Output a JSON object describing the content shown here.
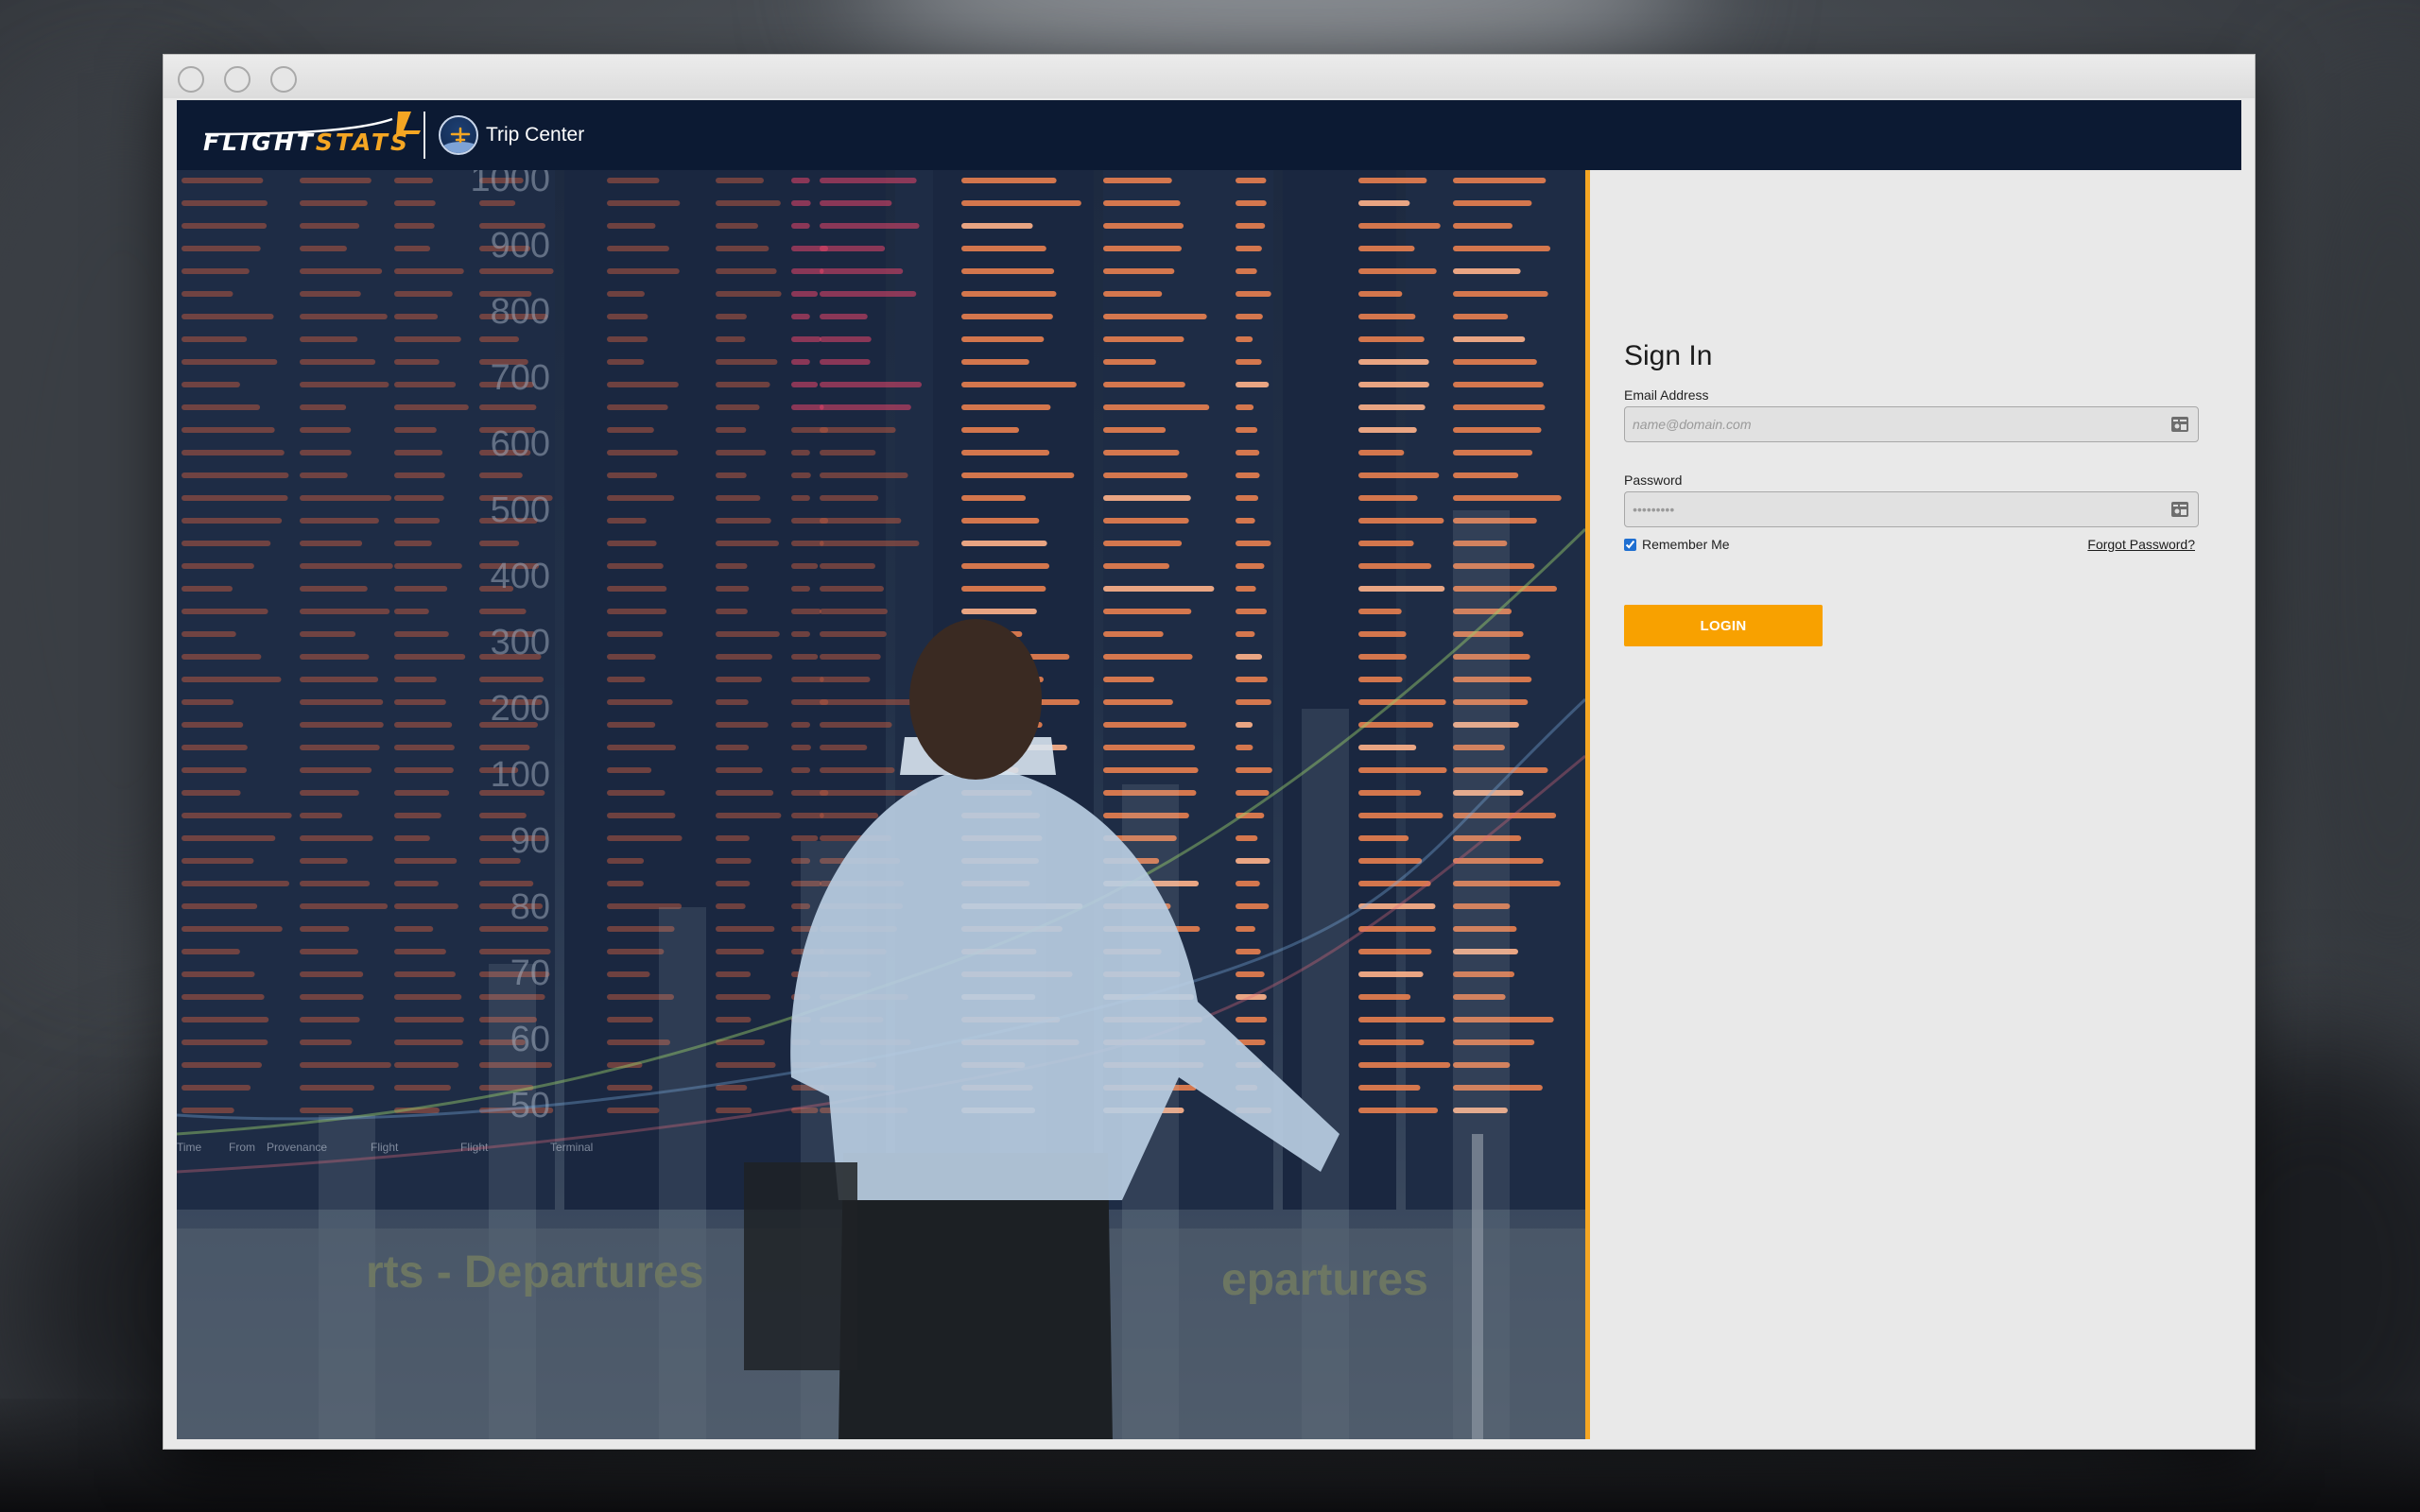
{
  "brand": {
    "logo_text_white": "FLIGHT",
    "logo_text_accent": "STATS",
    "product_name": "Trip Center",
    "accent_color": "#f5a623",
    "navbar_color": "#0c1a33"
  },
  "window": {
    "controls": [
      "close",
      "minimize",
      "zoom"
    ]
  },
  "hero": {
    "scale_labels": [
      "1000",
      "900",
      "800",
      "700",
      "600",
      "500",
      "400",
      "300",
      "200",
      "100",
      "90",
      "80",
      "70",
      "60",
      "50"
    ],
    "board_text_left": "rts - Departures",
    "board_text_right": "epartures",
    "board_headers": [
      "Time",
      "From",
      "Provenance",
      "Flight",
      "Flight",
      "Terminal"
    ]
  },
  "signin": {
    "title": "Sign In",
    "email_label": "Email Address",
    "email_placeholder": "name@domain.com",
    "email_value": "",
    "password_label": "Password",
    "password_placeholder": "•••••••••",
    "password_value": "",
    "remember_label": "Remember Me",
    "remember_checked": true,
    "forgot_label": "Forgot Password?",
    "login_label": "LOGIN",
    "login_color": "#f8a100"
  },
  "icons": {
    "email_field_icon": "contact-card-icon",
    "password_field_icon": "contact-card-icon",
    "product_icon": "globe-plane-icon"
  }
}
